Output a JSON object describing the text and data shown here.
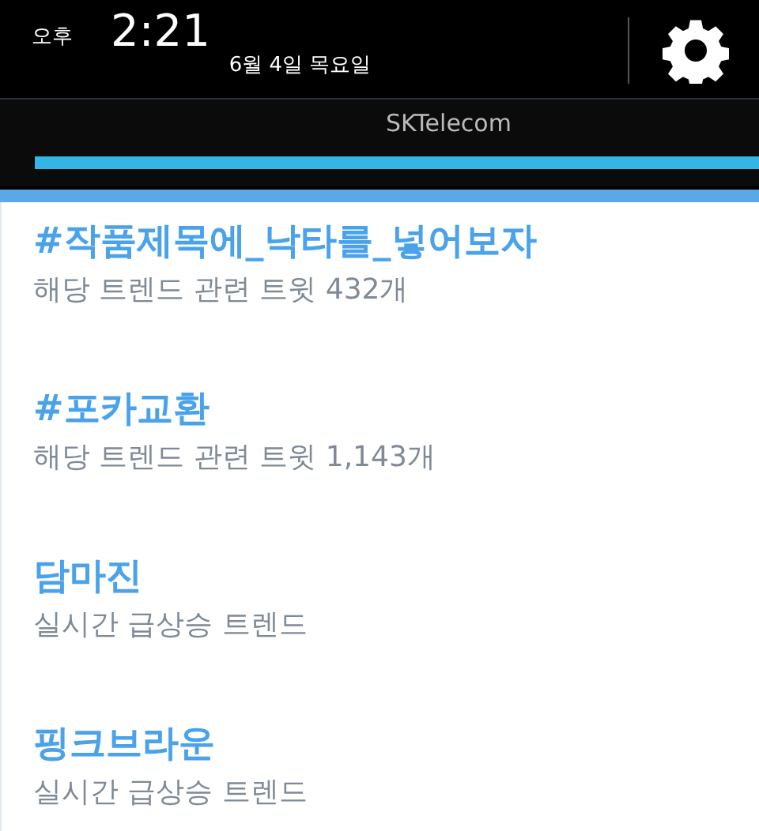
{
  "status": {
    "ampm": "오후",
    "time": "2:21",
    "date": "6월 4일 목요일"
  },
  "carrier": "SKTelecom",
  "trends": [
    {
      "title": "#작품제목에_낙타를_넣어보자",
      "subtitle": "해당 트렌드 관련 트윗 432개"
    },
    {
      "title": "#포카교환",
      "subtitle": "해당 트렌드 관련 트윗 1,143개"
    },
    {
      "title": "담마진",
      "subtitle": "실시간 급상승 트렌드"
    },
    {
      "title": "핑크브라운",
      "subtitle": "실시간 급상승 트렌드"
    }
  ]
}
